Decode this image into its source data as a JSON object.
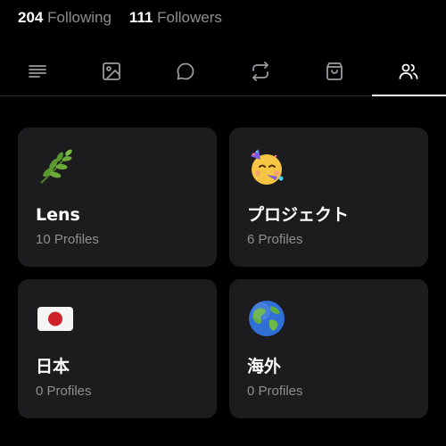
{
  "stats": {
    "following_count": "204",
    "following_label": "Following",
    "followers_count": "111",
    "followers_label": "Followers"
  },
  "tabs": [
    {
      "icon": "text-lines-icon",
      "active": false
    },
    {
      "icon": "image-icon",
      "active": false
    },
    {
      "icon": "comment-icon",
      "active": false
    },
    {
      "icon": "repost-icon",
      "active": false
    },
    {
      "icon": "shopping-bag-icon",
      "active": false
    },
    {
      "icon": "people-icon",
      "active": true
    }
  ],
  "lists": [
    {
      "emoji": "herb-icon",
      "name": "Lens",
      "count": "10 Profiles"
    },
    {
      "emoji": "party-face-icon",
      "name": "プロジェクト",
      "count": "6 Profiles"
    },
    {
      "emoji": "japan-flag-icon",
      "name": "日本",
      "count": "0 Profiles"
    },
    {
      "emoji": "globe-icon",
      "name": "海外",
      "count": "0 Profiles"
    }
  ],
  "colors": {
    "background": "#000000",
    "card": "#1c1c1e",
    "muted_text": "#8e8e93",
    "divider": "#2c2c2e"
  }
}
